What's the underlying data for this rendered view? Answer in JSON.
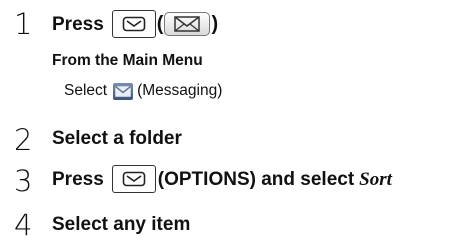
{
  "steps": [
    {
      "number": "1",
      "prefix": "Press",
      "paren_open": "(",
      "paren_close": ")",
      "key_icon": "mail-key-icon",
      "softkey_icon": "envelope-softkey-icon"
    },
    {
      "number": "2",
      "text": "Select a folder"
    },
    {
      "number": "3",
      "prefix": "Press",
      "suffix": "(OPTIONS) and select",
      "emphasis": "Sort",
      "key_icon": "mail-key-icon"
    },
    {
      "number": "4",
      "text": "Select any item"
    }
  ],
  "main_menu_note": {
    "heading": "From the Main Menu",
    "select_label": "Select",
    "item_label": "(Messaging)",
    "item_icon": "messaging-icon"
  },
  "colors": {
    "text": "#111111",
    "key_border": "#333333",
    "messaging_icon": "#4a6186"
  }
}
